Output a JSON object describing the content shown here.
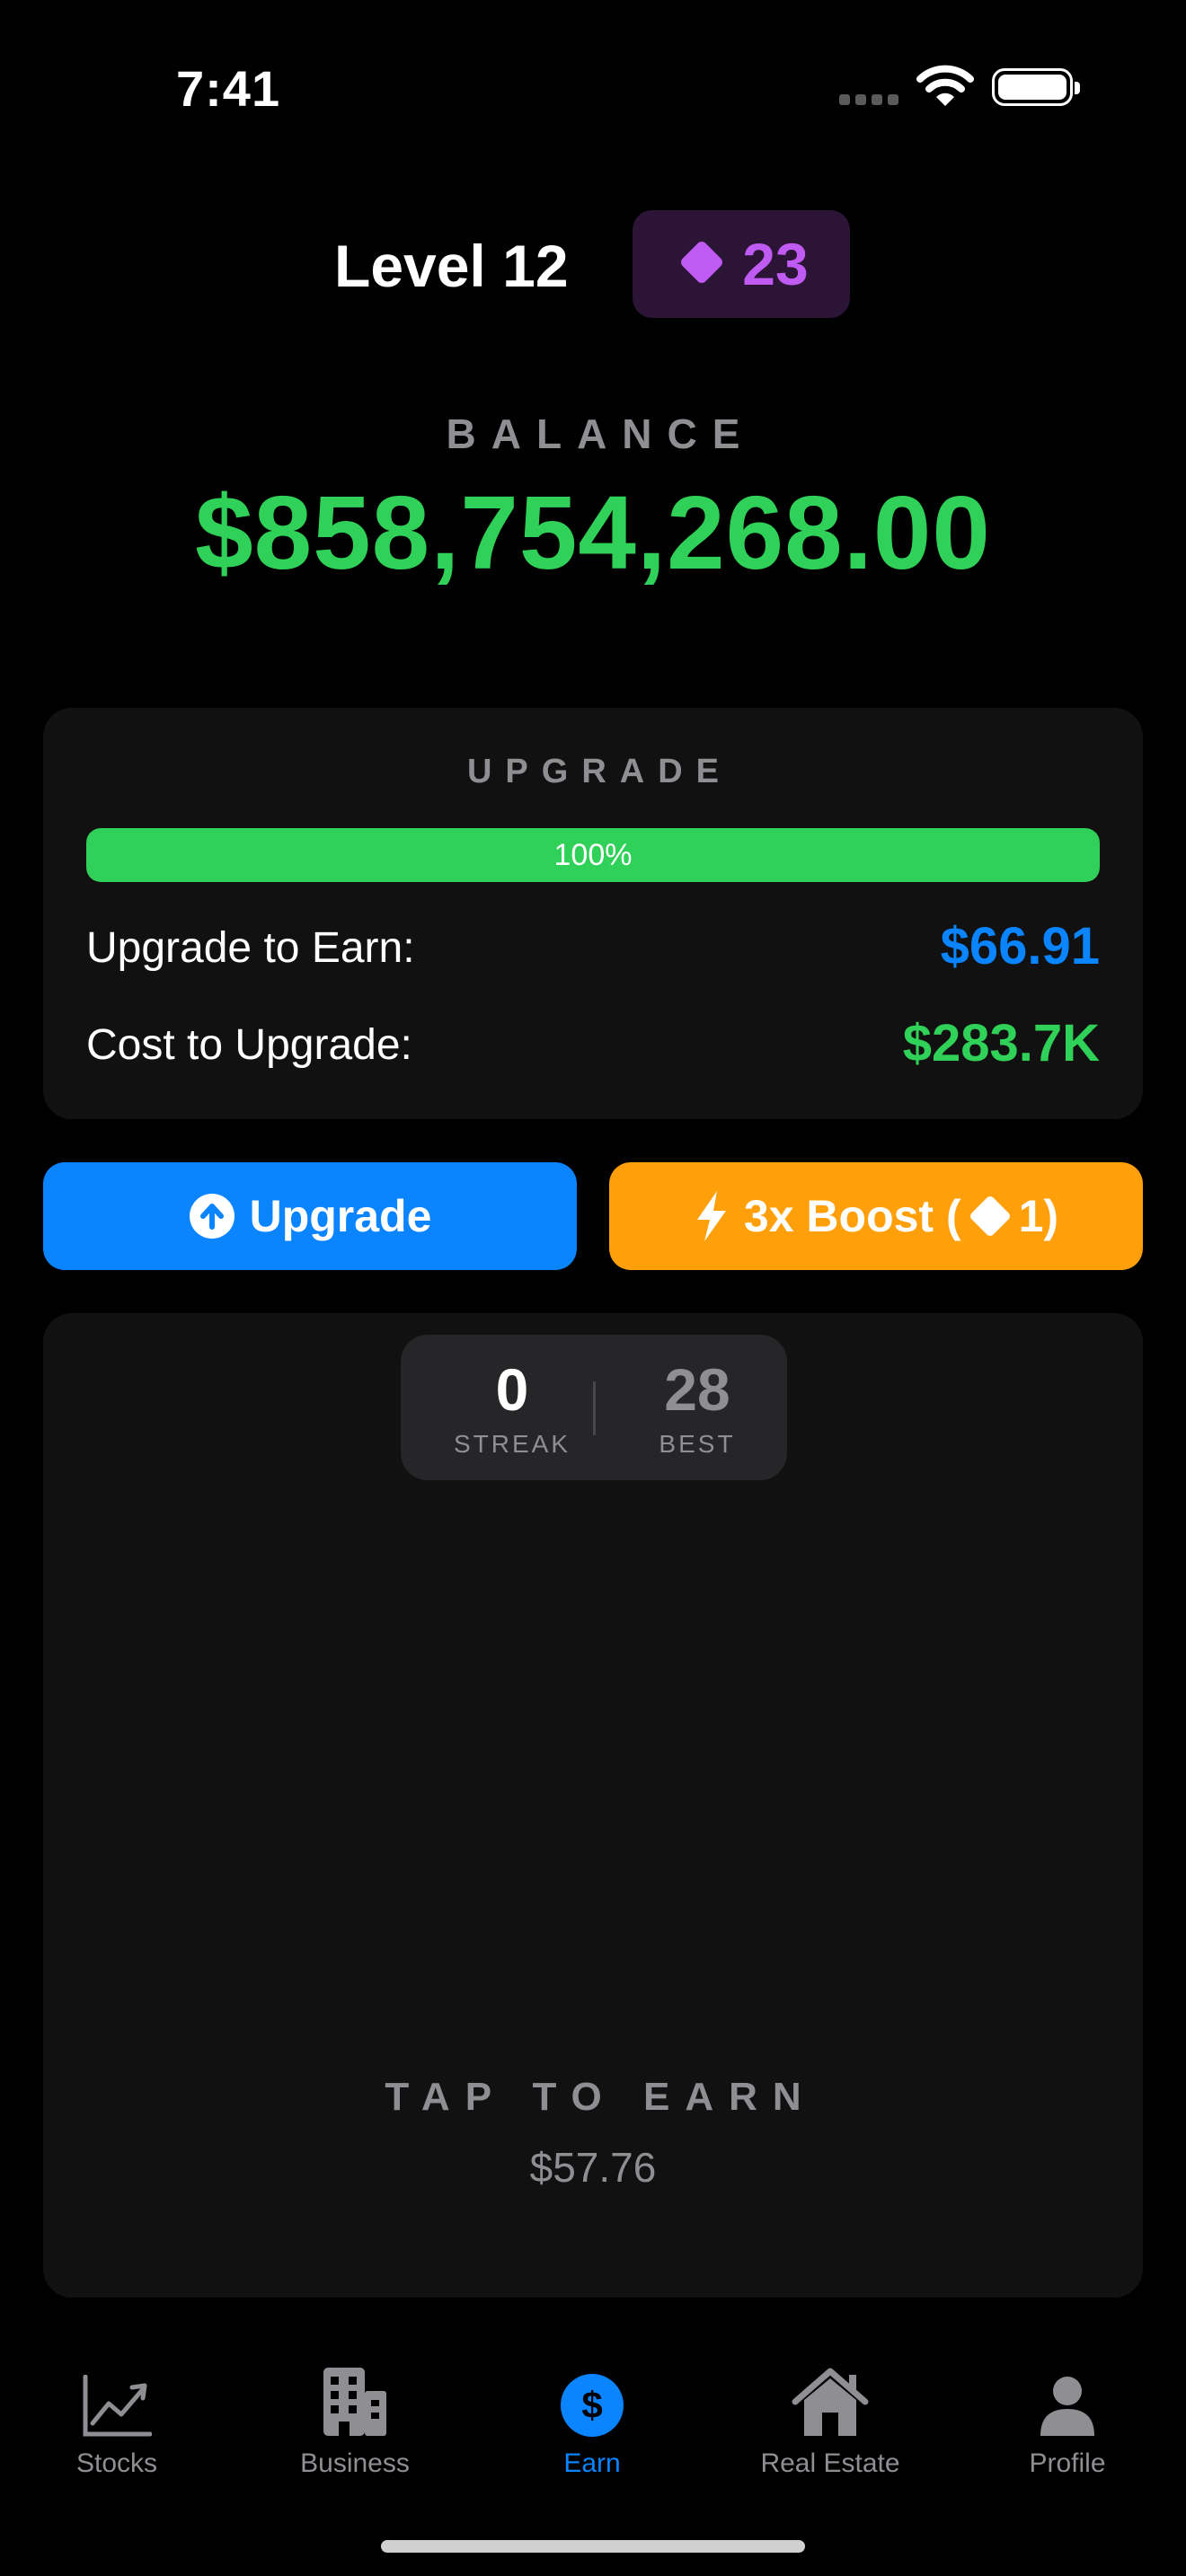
{
  "status_bar": {
    "time": "7:41"
  },
  "header": {
    "level": "Level 12",
    "gems": "23",
    "gem_icon": "diamond-icon",
    "gem_color": "#bf5af2"
  },
  "balance": {
    "label": "BALANCE",
    "value": "$858,754,268.00",
    "color": "#30d158"
  },
  "upgrade": {
    "heading": "UPGRADE",
    "progress_percent": 100,
    "progress_text": "100%",
    "earn_label": "Upgrade to Earn:",
    "earn_value": "$66.91",
    "earn_color": "#0a84ff",
    "cost_label": "Cost to Upgrade:",
    "cost_value": "$283.7K",
    "cost_color": "#30d158"
  },
  "actions": {
    "upgrade_label": "Upgrade",
    "upgrade_icon": "arrow-up-circle-icon",
    "boost_label_pre": "3x Boost (",
    "boost_label_post": "1)",
    "boost_icon": "bolt-icon"
  },
  "tap": {
    "streak_value": "0",
    "streak_caption": "STREAK",
    "best_value": "28",
    "best_caption": "BEST",
    "label": "TAP TO EARN",
    "amount": "$57.76"
  },
  "tabs": [
    {
      "label": "Stocks",
      "icon": "chart-line-icon"
    },
    {
      "label": "Business",
      "icon": "building-icon"
    },
    {
      "label": "Earn",
      "icon": "dollar-circle-icon",
      "active": true
    },
    {
      "label": "Real Estate",
      "icon": "house-icon"
    },
    {
      "label": "Profile",
      "icon": "person-icon"
    }
  ]
}
